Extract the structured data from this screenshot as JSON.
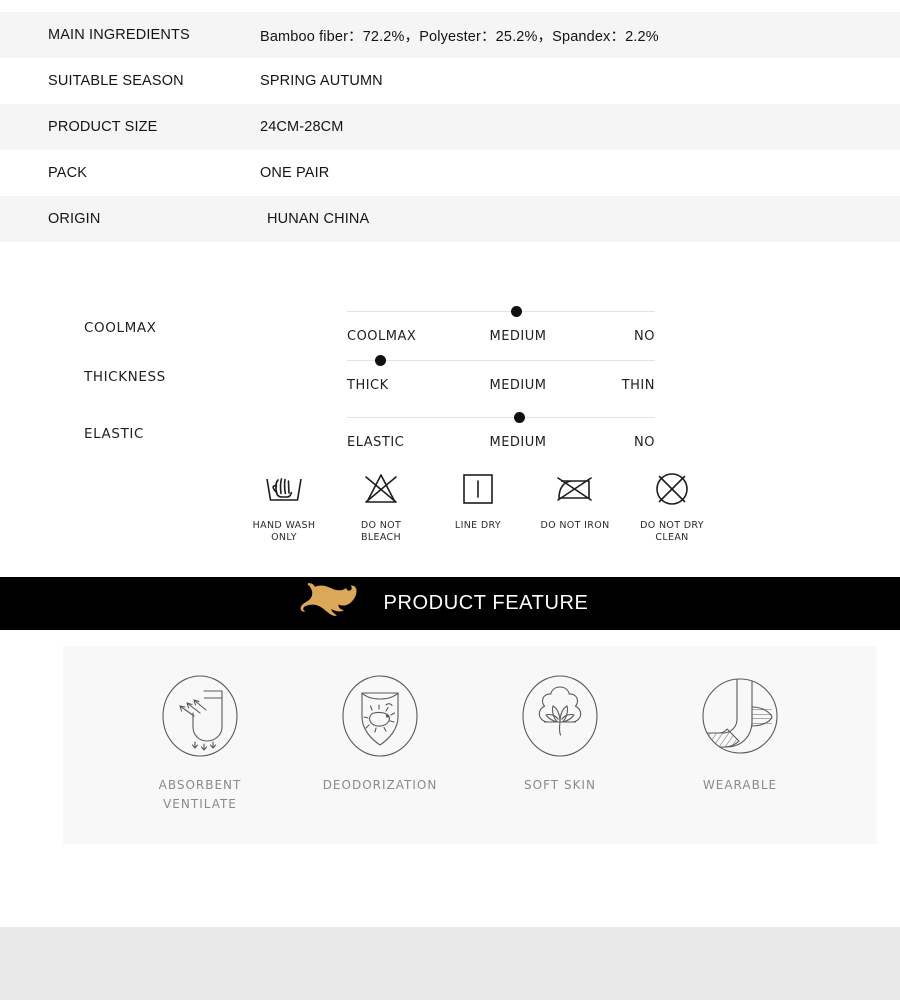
{
  "spec_table": {
    "rows": [
      {
        "label": "MAIN INGREDIENTS",
        "value": "Bamboo fiber：72.2%，Polyester：25.2%，Spandex：2.2%"
      },
      {
        "label": "SUITABLE SEASON",
        "value": "SPRING  AUTUMN"
      },
      {
        "label": "PRODUCT SIZE",
        "value": "24CM-28CM"
      },
      {
        "label": "PACK",
        "value": "ONE PAIR"
      },
      {
        "label": "ORIGIN",
        "value": "HUNAN CHINA"
      }
    ],
    "shade_color": "#f5f5f5"
  },
  "ratings": [
    {
      "name": "COOLMAX",
      "scale_start": "COOLMAX",
      "scale_mid": "MEDIUM",
      "scale_end": "NO",
      "marker_percent": 55
    },
    {
      "name": "THICKNESS",
      "scale_start": "THICK",
      "scale_mid": "MEDIUM",
      "scale_end": "THIN",
      "marker_percent": 11
    },
    {
      "name": "ELASTIC",
      "scale_start": "ELASTIC",
      "scale_mid": "MEDIUM",
      "scale_end": "NO",
      "marker_percent": 56
    }
  ],
  "care_instructions": [
    {
      "icon": "hand-wash-icon",
      "label": "HAND WASH\nONLY"
    },
    {
      "icon": "do-not-bleach-icon",
      "label": "DO NOT\nBLEACH"
    },
    {
      "icon": "line-dry-icon",
      "label": "LINE DRY"
    },
    {
      "icon": "do-not-iron-icon",
      "label": "DO NOT IRON"
    },
    {
      "icon": "do-not-dry-clean-icon",
      "label": "DO NOT DRY\nCLEAN"
    }
  ],
  "banner": {
    "title": "PRODUCT FEATURE",
    "logo_icon": "leaping-lion-logo",
    "logo_color": "#d9a css",
    "logo_color_hex": "#dba85a",
    "background_color": "#000000",
    "text_color": "#ffffff"
  },
  "features": [
    {
      "icon": "sock-airflow-icon",
      "label": "ABSORBENT\nVENTILATE"
    },
    {
      "icon": "shield-germ-icon",
      "label": "DEODORIZATION"
    },
    {
      "icon": "cotton-boll-icon",
      "label": "SOFT SKIN"
    },
    {
      "icon": "sock-reinforced-icon",
      "label": "WEARABLE"
    }
  ],
  "feature_panel": {
    "background_color": "#f8f8f8",
    "label_color": "#8a8a8a"
  },
  "bottom_band": {
    "background_color": "#e9e9e9"
  }
}
